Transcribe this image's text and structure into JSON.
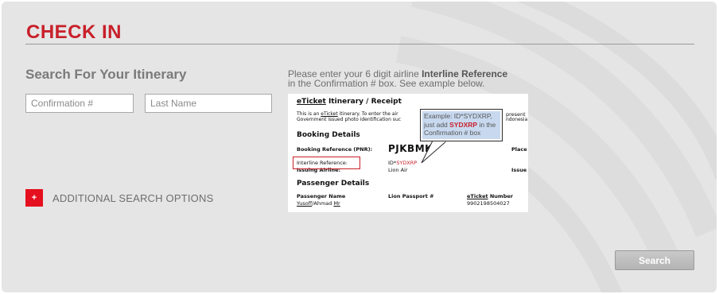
{
  "header": {
    "title": "CHECK IN"
  },
  "search": {
    "title": "Search For Your Itinerary",
    "confirmation_placeholder": "Confirmation #",
    "lastname_placeholder": "Last Name"
  },
  "additional": {
    "icon": "+",
    "label": "ADDITIONAL SEARCH OPTIONS"
  },
  "instructions": {
    "line1_prefix": "Please enter your 6 digit airline ",
    "line1_bold": "Interline Reference",
    "line2": "in the Confirmation # box. See example below."
  },
  "example": {
    "heading_u": "eTicket",
    "heading_rest": " Itinerary / Receipt",
    "note_line1_a": "This is an ",
    "note_line1_u": "eTicket",
    "note_line1_b": " itinerary. To enter the air",
    "note_line1_c": "present",
    "note_line2_a": "Government issued photo identification suc",
    "note_line2_b": "ndonesia",
    "booking_heading": "Booking Details",
    "booking_ref_label": "Booking Reference (PNR):",
    "pnr_value": "PJKBMK",
    "place_label": "Place",
    "interline_label": "Interline Reference:",
    "interline_prefix": "ID*",
    "interline_code": "SYDXRP",
    "issuing_label": "Issuing Airline:",
    "issuing_value": "Lion Air",
    "issue_label": "Issue",
    "passenger_heading": "Passenger Details",
    "col_passenger": "Passenger Name",
    "col_passport": "Lion Passport #",
    "col_ticket_u": "eTicket",
    "col_ticket_rest": " Number",
    "passenger_u1": "Yusoff",
    "passenger_mid": "/Ahmad ",
    "passenger_u2": "Mr",
    "ticket_number": "9902198504027",
    "callout_line1": "Example: ID*SYDXRP,",
    "callout_line2_a": "just add ",
    "callout_line2_code": "SYDXRP",
    "callout_line2_b": " in the",
    "callout_line3": "Confirmation # box"
  },
  "actions": {
    "search_label": "Search"
  },
  "colors": {
    "brand_red": "#c8202a",
    "accent_red": "#e5101f",
    "panel_bg": "#e5e5e5",
    "callout_bg": "#c8d9ef"
  }
}
